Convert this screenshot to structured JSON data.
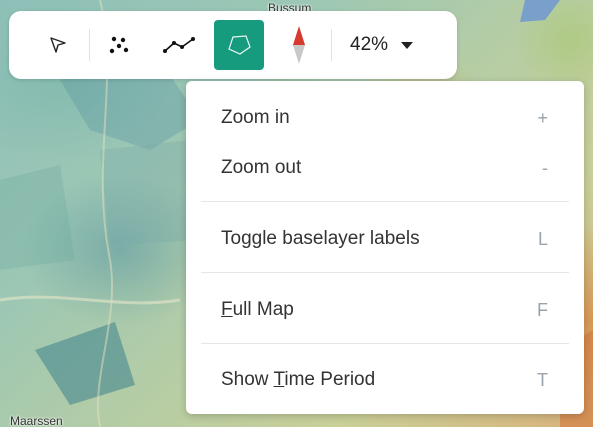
{
  "map": {
    "labels": [
      "Bussum",
      "Maarssen"
    ]
  },
  "toolbar": {
    "tools": [
      {
        "name": "select",
        "icon": "pointer-icon"
      },
      {
        "name": "points",
        "icon": "points-icon"
      },
      {
        "name": "line",
        "icon": "polyline-icon"
      },
      {
        "name": "polygon",
        "icon": "polygon-icon",
        "active": true
      },
      {
        "name": "compass",
        "icon": "compass-icon"
      }
    ],
    "zoom": {
      "value": "42%",
      "icon": "caret-down-icon"
    },
    "active_color": "#169b7f"
  },
  "menu": {
    "items": [
      {
        "label": "Zoom in",
        "shortcut": "+"
      },
      {
        "label": "Zoom out",
        "shortcut": "-"
      },
      {
        "label": "Toggle baselayer labels",
        "shortcut": "L"
      },
      {
        "label_prefix": "",
        "label_underlined": "F",
        "label_suffix": "ull Map",
        "shortcut": "F"
      },
      {
        "label_prefix": "Show ",
        "label_underlined": "T",
        "label_suffix": "ime Period",
        "shortcut": "T"
      }
    ]
  }
}
